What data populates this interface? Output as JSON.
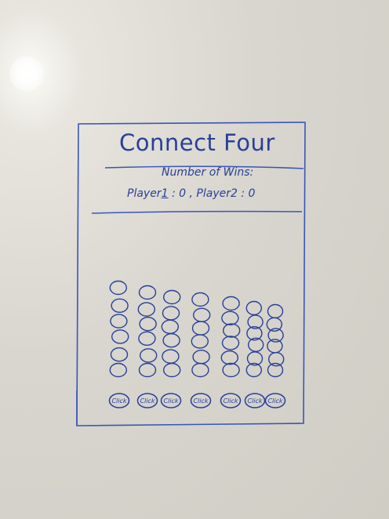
{
  "app": {
    "title": "Connect Four"
  },
  "scoreboard": {
    "heading": "Number of Wins:",
    "player1_label": "Player",
    "player1_number": "1",
    "player1_wins": "0",
    "player2_label": "Player2",
    "player2_wins": "0"
  },
  "board": {
    "columns": 7,
    "rows": 6,
    "drop_button_label": "Click",
    "ink_color": "#2a3f99"
  }
}
